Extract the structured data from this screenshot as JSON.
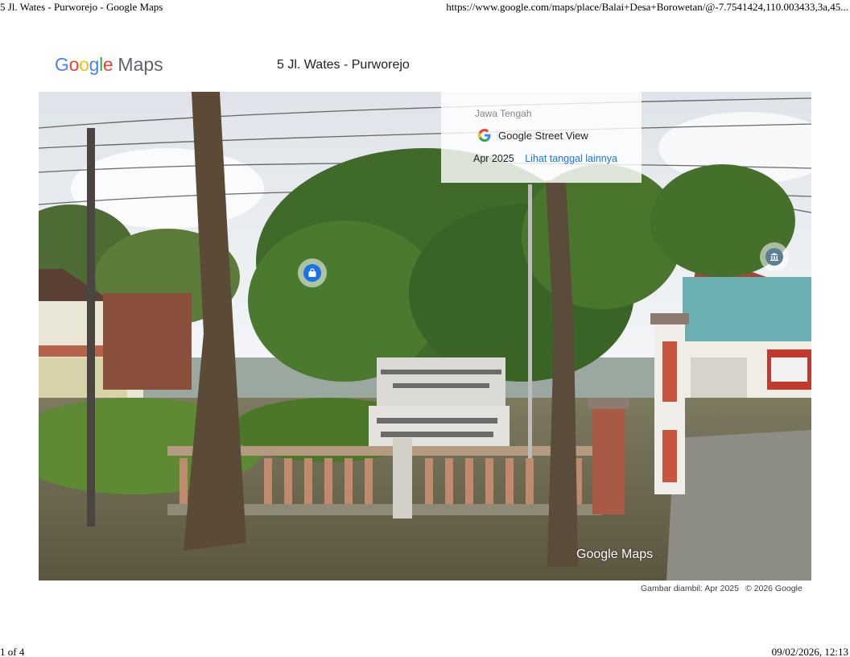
{
  "print_header": {
    "title": "5 Jl. Wates - Purworejo - Google Maps",
    "url": "https://www.google.com/maps/place/Balai+Desa+Borowetan/@-7.7541424,110.003433,3a,45..."
  },
  "print_footer": {
    "page": "1 of 4",
    "datetime": "09/02/2026, 12:13"
  },
  "header": {
    "logo_google": [
      "G",
      "o",
      "o",
      "g",
      "l",
      "e"
    ],
    "logo_maps": "Maps",
    "place_title": "5 Jl. Wates - Purworejo"
  },
  "street_view": {
    "region": "Jawa Tengah",
    "brand": "Google Street View",
    "date": "Apr 2025",
    "more_dates_link": "Lihat tanggal lainnya",
    "watermark": "Google Maps",
    "markers": [
      {
        "icon": "shopping-bag-icon",
        "color": "#1a73e8"
      },
      {
        "icon": "institution-icon",
        "color": "#5b7f95"
      }
    ]
  },
  "attribution": {
    "capture_date": "Gambar diambil: Apr 2025",
    "copyright": "© 2026 Google"
  },
  "colors": {
    "google_blue": "#4285f4",
    "google_red": "#ea4335",
    "google_yellow": "#fbbc05",
    "google_green": "#34a853",
    "link_blue": "#1a73e8"
  }
}
